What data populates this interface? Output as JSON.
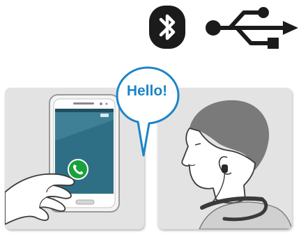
{
  "speech_bubble": {
    "text": "Hello!"
  },
  "icons": {
    "top_left": "bluetooth-icon",
    "top_right": "usb-icon",
    "call_button": "phone-call-icon"
  },
  "colors": {
    "bluetooth_bg": "#1b1b1b",
    "accent_blue": "#1a84c9",
    "call_green": "#1aa13b",
    "panel_bg": "#e3e3e3"
  }
}
